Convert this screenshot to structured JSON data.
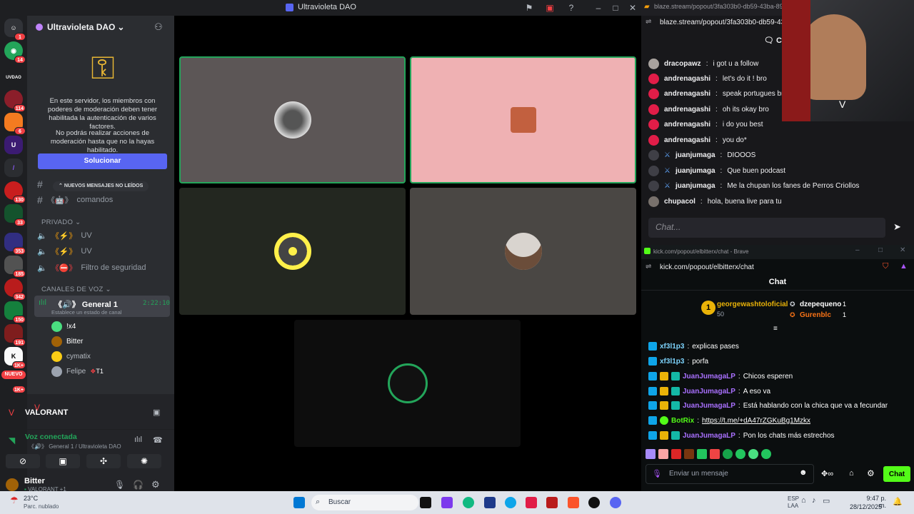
{
  "discord": {
    "window_title": "Ultravioleta DAO",
    "server_name": "Ultravioleta DAO",
    "notice_1": "En este servidor, los miembros con poderes de moderación deben tener habilitada la autenticación de varios factores.",
    "notice_2": "No podrás realizar acciones de moderación hasta que no la hayas habilitado.",
    "fix_button": "Solucionar",
    "unread_pill": "NUEVOS MENSAJES NO LEÍDOS",
    "channels": [
      {
        "label": "comandos"
      }
    ],
    "categories": {
      "private": "PRIVADO",
      "voice": "CANALES DE VOZ"
    },
    "private_channels": [
      "UV",
      "UV",
      "Filtro de seguridad"
    ],
    "voice_channel": {
      "name": "General 1",
      "timer": "2:22:10",
      "status": "Establece un estado de canal"
    },
    "voice_users": [
      "!x4",
      "Bitter",
      "cymatix",
      "Felipe"
    ],
    "felipe_tag": "T1",
    "activity": "VALORANT",
    "voice_connected": "Voz conectada",
    "voice_location": "General 1 / Ultravioleta DAO",
    "user_name": "Bitter",
    "user_status": "VALORANT +1",
    "server_badges": [
      "1",
      "14",
      "114",
      "6",
      "130",
      "33",
      "353",
      "185",
      "342",
      "150",
      "191",
      "1K+",
      "NUEVO",
      "1K+"
    ]
  },
  "colors": {
    "blurple": "#5865f2",
    "voice_green": "#23a55a",
    "kick_green": "#53fc18",
    "tile_pink": "#efb1b3"
  },
  "brave1": {
    "url": "blaze.stream/popout/3fa303b0-db59-43ba-89b5-9",
    "address": "blaze.stream/popout/3fa303b0-db59-43b",
    "header": "Ch",
    "messages": [
      {
        "user": "dracopawz",
        "text": "i got u a follow"
      },
      {
        "user": "andrenagashi",
        "text": "let's do it ! bro"
      },
      {
        "user": "andrenagashi",
        "text": "speak portugues bro?"
      },
      {
        "user": "andrenagashi",
        "text": "oh its okay bro"
      },
      {
        "user": "andrenagashi",
        "text": "i do you best"
      },
      {
        "user": "andrenagashi",
        "text": "you do*"
      },
      {
        "user": "juanjumaga",
        "text": "DIOOOS"
      },
      {
        "user": "juanjumaga",
        "text": "Que buen podcast"
      },
      {
        "user": "juanjumaga",
        "text": "Me la chupan los fanes de Perros Criollos"
      },
      {
        "user": "chupacol",
        "text": "hola, buena live para tu"
      }
    ],
    "input_placeholder": "Chat..."
  },
  "kick": {
    "window_url": "kick.com/popout/elbitterx/chat - Brave",
    "address": "kick.com/popout/elbitterx/chat",
    "title": "Chat",
    "leaderboard": {
      "first": {
        "name": "georgewashtoloficial",
        "count": "50"
      },
      "second": {
        "name": "dzepequeno",
        "count": "1"
      },
      "third": {
        "name": "Gurenblc",
        "count": "1"
      }
    },
    "messages": [
      {
        "user": "xf3l1p3",
        "text": "explicas pases",
        "color": "#7dd3fc"
      },
      {
        "user": "xf3l1p3",
        "text": "porfa",
        "color": "#7dd3fc"
      },
      {
        "user": "JuanJumagaLP",
        "text": "Chicos esperen",
        "color": "#a970ff"
      },
      {
        "user": "JuanJumagaLP",
        "text": "A eso va",
        "color": "#a970ff"
      },
      {
        "user": "JuanJumagaLP",
        "text": "Está hablando con la chica que va a fecundar",
        "color": "#a970ff"
      },
      {
        "user": "BotRix",
        "text": "https://t.me/+dA47rZGKuBg1Mzkx",
        "color": "#53fc18"
      },
      {
        "user": "JuanJumagaLP",
        "text": "Pon los chats más estrechos",
        "color": "#a970ff"
      }
    ],
    "input_placeholder": "Enviar un mensaje",
    "send_button": "Chat"
  },
  "taskbar": {
    "temp": "23°C",
    "weather": "Parc. nublado",
    "search": "Buscar",
    "lang1": "ESP",
    "lang2": "LAA",
    "time": "9:47 p. m.",
    "date": "28/12/2025"
  }
}
